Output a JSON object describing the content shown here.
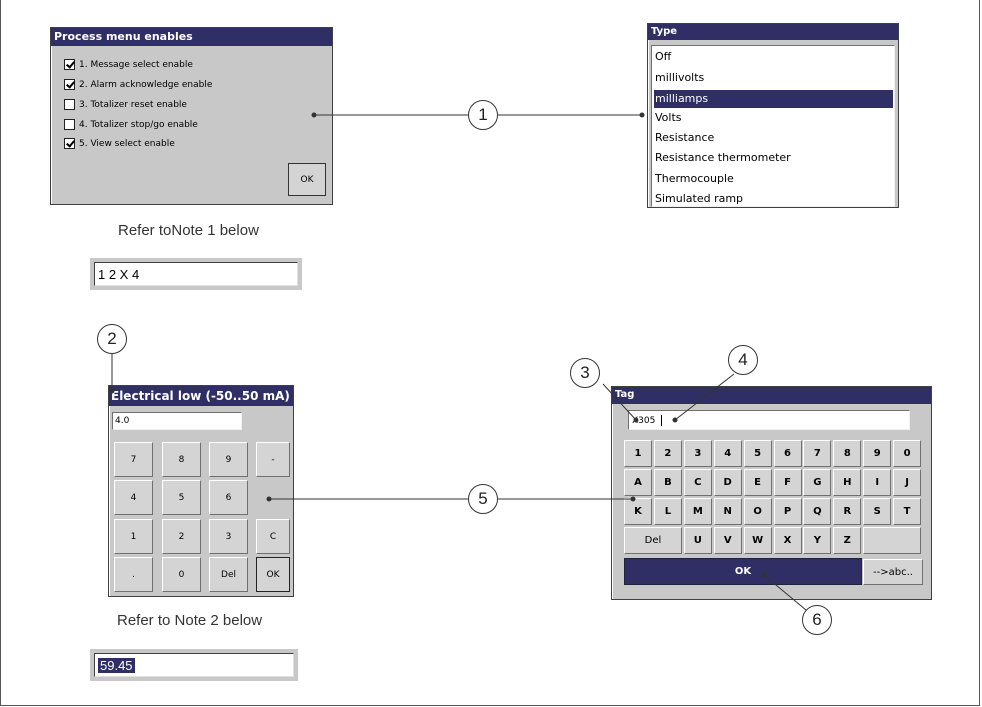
{
  "process_menu": {
    "title": "Process menu enables",
    "items": [
      {
        "label": "1. Message select enable",
        "checked": true
      },
      {
        "label": "2. Alarm acknowledge enable",
        "checked": true
      },
      {
        "label": "3. Totalizer reset enable",
        "checked": false
      },
      {
        "label": "4. Totalizer stop/go enable",
        "checked": false
      },
      {
        "label": "5. View select enable",
        "checked": true
      }
    ],
    "ok_label": "OK"
  },
  "type_list": {
    "title": "Type",
    "options": [
      "Off",
      "millivolts",
      "milliamps",
      "Volts",
      "Resistance",
      "Resistance thermometer",
      "Thermocouple",
      "Simulated ramp"
    ],
    "selected": "milliamps"
  },
  "note1": {
    "caption": "Refer toNote 1 below",
    "field_value": "1 2 X 4"
  },
  "numeric_pad": {
    "title": "Electrical low (-50..50 mA)",
    "value": "4.0",
    "keys": [
      "7",
      "8",
      "9",
      "-",
      "4",
      "5",
      "6",
      "1",
      "2",
      "3",
      "C",
      ".",
      "0",
      "Del",
      "OK"
    ]
  },
  "note2": {
    "caption": "Refer to Note 2 below",
    "field_value": "59.45"
  },
  "tag_keyboard": {
    "title": "Tag",
    "value": "X305",
    "row1": [
      "1",
      "2",
      "3",
      "4",
      "5",
      "6",
      "7",
      "8",
      "9",
      "0"
    ],
    "row2": [
      "A",
      "B",
      "C",
      "D",
      "E",
      "F",
      "G",
      "H",
      "I",
      "J"
    ],
    "row3": [
      "K",
      "L",
      "M",
      "N",
      "O",
      "P",
      "Q",
      "R",
      "S",
      "T"
    ],
    "row4": [
      "Del",
      "U",
      "V",
      "W",
      "X",
      "Y",
      "Z"
    ],
    "ok_label": "OK",
    "switch_label": "-->abc.."
  },
  "callouts": [
    "1",
    "2",
    "3",
    "4",
    "5",
    "6"
  ],
  "colors": {
    "titlebar": "#2f2f66",
    "dialog_bg": "#c8c8c8",
    "selection": "#2f2f66"
  }
}
